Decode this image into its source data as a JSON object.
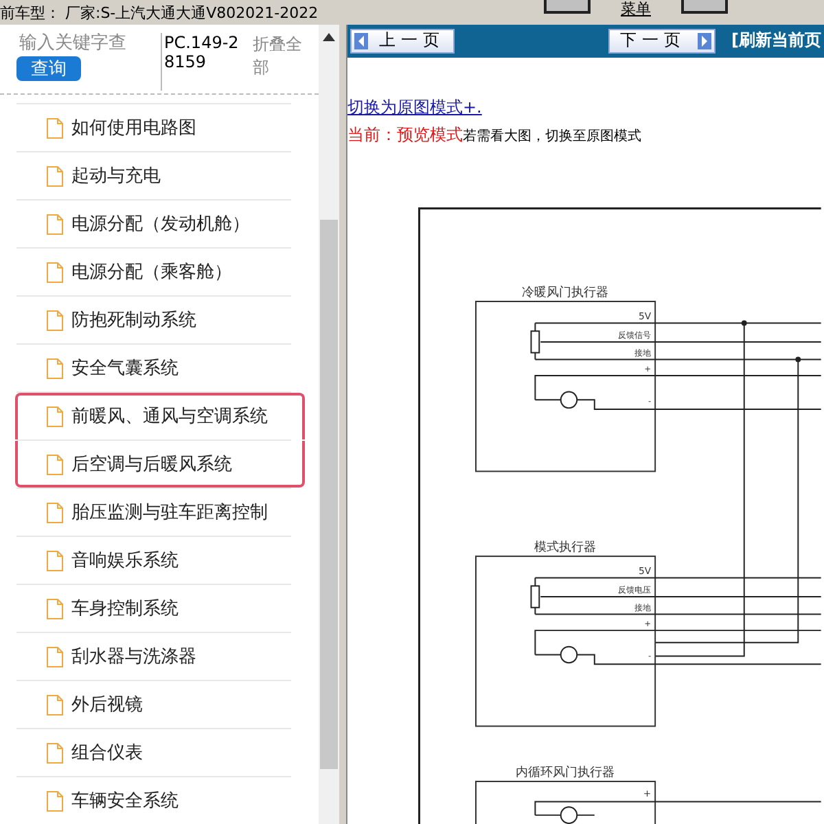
{
  "top_bar": {
    "vehicle": "前车型： 厂家:S-上汽大通大通V802021-2022",
    "menu": "菜单"
  },
  "sidebar": {
    "search": {
      "placeholder": "输入关键字查"
    },
    "query_button": "查询",
    "code": "PC.149-28159",
    "collapse": "折叠全部",
    "items": [
      {
        "label": "如何使用电路图",
        "highlighted": false
      },
      {
        "label": "起动与充电",
        "highlighted": false
      },
      {
        "label": "电源分配（发动机舱）",
        "highlighted": false
      },
      {
        "label": "电源分配（乘客舱）",
        "highlighted": false
      },
      {
        "label": "防抱死制动系统",
        "highlighted": false
      },
      {
        "label": "安全气囊系统",
        "highlighted": false
      },
      {
        "label": "前暖风、通风与空调系统",
        "highlighted": true
      },
      {
        "label": "后空调与后暖风系统",
        "highlighted": true
      },
      {
        "label": "胎压监测与驻车距离控制",
        "highlighted": false
      },
      {
        "label": "音响娱乐系统",
        "highlighted": false
      },
      {
        "label": "车身控制系统",
        "highlighted": false
      },
      {
        "label": "刮水器与洗涤器",
        "highlighted": false
      },
      {
        "label": "外后视镜",
        "highlighted": false
      },
      {
        "label": "组合仪表",
        "highlighted": false
      },
      {
        "label": "车辆安全系统",
        "highlighted": false
      }
    ]
  },
  "nav": {
    "prev": "上一页",
    "next": "下一页",
    "refresh": "[刷新当前页"
  },
  "mode": {
    "switch_link": "切换为原图模式+.",
    "current": "当前：预览模式",
    "hint": "若需看大图，切换至原图模式"
  },
  "diagram": {
    "blocks": [
      {
        "kind": "sensor_motor",
        "title": "冷暖风门执行器",
        "pins": [
          "5V",
          "反馈信号",
          "接地",
          "+",
          "-"
        ]
      },
      {
        "kind": "sensor_motor",
        "title": "模式执行器",
        "pins": [
          "5V",
          "反馈电压",
          "接地",
          "+",
          "-"
        ]
      },
      {
        "kind": "motor",
        "title": "内循环风门执行器",
        "pins": [
          "+"
        ]
      }
    ]
  }
}
